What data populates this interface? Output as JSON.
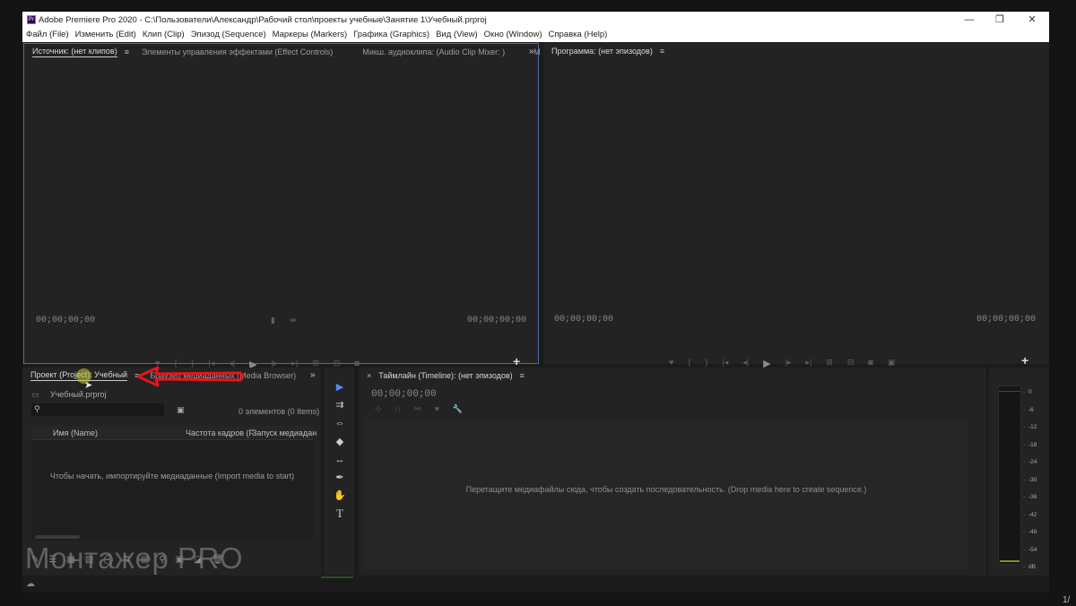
{
  "window": {
    "app_icon": "Pr",
    "title": "Adobe Premiere Pro 2020 - C:\\Пользователи\\Александр\\Рабочий стол\\проекты учебные\\Занятие 1\\Учебный.prproj",
    "controls": {
      "minimize": "—",
      "restore": "❐",
      "close": "✕"
    }
  },
  "menu": [
    "Файл (File)",
    "Изменить (Edit)",
    "Клип (Clip)",
    "Эпизод (Sequence)",
    "Маркеры (Markers)",
    "Графика (Graphics)",
    "Вид (View)",
    "Окно (Window)",
    "Справка (Help)"
  ],
  "source_panel": {
    "tabs": [
      "Источник: (нет клипов)",
      "Элементы управления эффектами (Effect Controls)",
      "Микш. аудиоклипа: (Audio Clip Mixer: )",
      "M"
    ],
    "menu_glyph": "≡",
    "overflow_glyph": "»",
    "timecode_left": "00;00;00;00",
    "timecode_right": "00;00;00;00",
    "add_glyph": "+"
  },
  "program_panel": {
    "tab": "Программа: (нет эпизодов)",
    "menu_glyph": "≡",
    "timecode_left": "00;00;00;00",
    "timecode_right": "00;00;00;00",
    "add_glyph": "+"
  },
  "project_panel": {
    "tabs": [
      "Проект (Project): Учебный",
      "Браузер медиаданных (Media Browser)"
    ],
    "menu_glyph": "≡",
    "overflow_glyph": "»",
    "file": "Учебный.prproj",
    "item_count": "0 элементов (0 Items)",
    "columns": [
      "Имя (Name)",
      "Частота кадров (F",
      "Запуск медиадан"
    ],
    "empty_message": "Чтобы начать, импортируйте медиаданные (Import media to start)"
  },
  "timeline_panel": {
    "close_glyph": "×",
    "tab": "Таймлайн (Timeline): (нет эпизодов)",
    "menu_glyph": "≡",
    "timecode": "00;00;00;00",
    "drop_message": "Перетащите медиафайлы сюда, чтобы создать последовательность. (Drop media here to create sequence.)"
  },
  "audio_meter": {
    "levels": [
      "0",
      "-6",
      "-12",
      "-18",
      "-24",
      "-30",
      "-36",
      "-42",
      "-48",
      "-54",
      "dB"
    ]
  },
  "watermark": "Монтажер PRO",
  "page_indicator": "1/",
  "colors": {
    "accent_focus": "#4a6fa5",
    "annotation_arrow": "#e8141a",
    "selection_tool": "#4f8cf0"
  },
  "icons": [
    "premiere-app-icon",
    "selection-tool-icon",
    "track-select-forward-icon",
    "ripple-edit-icon",
    "razor-icon",
    "slip-icon",
    "pen-icon",
    "hand-icon",
    "type-tool-icon",
    "wrench-icon",
    "search-icon",
    "new-bin-icon"
  ]
}
